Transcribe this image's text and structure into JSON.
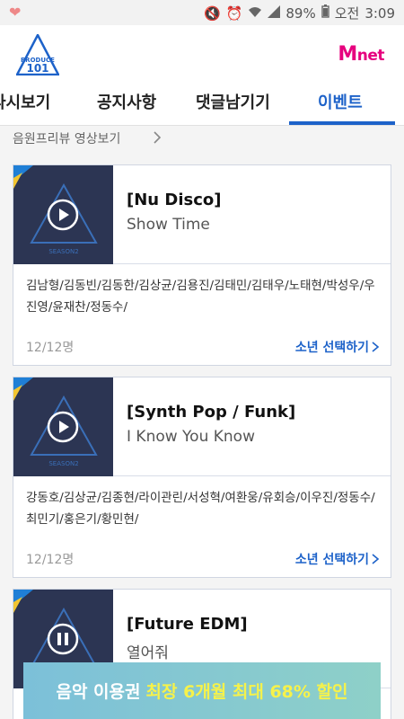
{
  "status": {
    "battery": "89%",
    "ampm": "오전",
    "time": "3:09"
  },
  "tabs": [
    {
      "label": "다시보기",
      "active": false
    },
    {
      "label": "공지사항",
      "active": false
    },
    {
      "label": "댓글남기기",
      "active": false
    },
    {
      "label": "이벤트",
      "active": true
    }
  ],
  "subnav": {
    "label": "음원프리뷰 영상보기"
  },
  "cards": [
    {
      "genre": "[Nu Disco]",
      "song": "Show Time",
      "members": "김남형/김동빈/김동한/김상균/김용진/김태민/김태우/노태현/박성우/우진영/윤재찬/정동수/",
      "count": "12/12명",
      "select_label": "소년 선택하기",
      "playing": false
    },
    {
      "genre": "[Synth Pop / Funk]",
      "song": "I Know You Know",
      "members": "강동호/김상균/김종현/라이관린/서성혁/여환웅/유회승/이우진/정동수/최민기/홍은기/황민현/",
      "count": "12/12명",
      "select_label": "소년 선택하기",
      "playing": false
    },
    {
      "genre": "[Future EDM]",
      "song": "열어줘",
      "members": "",
      "count": "",
      "select_label": "",
      "playing": true
    }
  ],
  "banner": {
    "text": "음악 이용권",
    "highlight": "최장 6개월 최대 68% 할인"
  },
  "colors": {
    "accent": "#1d62c9",
    "brand_mnet": "#e6007e",
    "banner_bg": "#7cc0d9",
    "banner_highlight": "#f6f24a"
  }
}
